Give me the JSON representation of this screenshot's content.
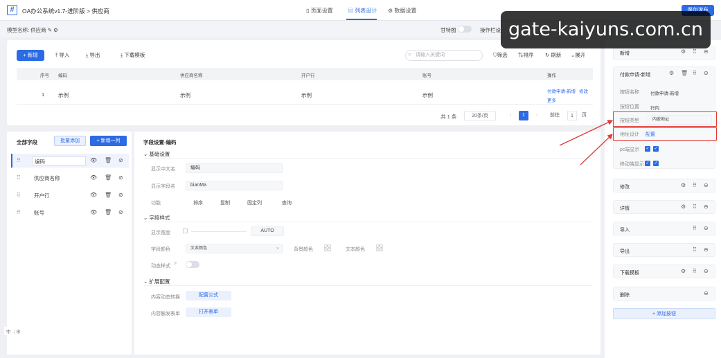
{
  "app": {
    "title": "OA办公系统v1.7-进阶版 > 供应商",
    "tabs": [
      {
        "label": "页面设置",
        "active": false
      },
      {
        "label": "列表设计",
        "active": true
      },
      {
        "label": "数据设置",
        "active": false
      }
    ],
    "save_label": "保存/发布"
  },
  "model": {
    "label": "模型名称: 供应商",
    "switch_label": "甘特图",
    "switch2_label": "操作栏设"
  },
  "preview": {
    "toolbar": [
      "+ 新增",
      "导入",
      "导出",
      "下载模板"
    ],
    "search_placeholder": "请输入关键词",
    "right_tools": [
      "筛选",
      "排序",
      "刷新",
      "展开"
    ],
    "columns": [
      "序号",
      "编码",
      "供应商名称",
      "开户行",
      "账号",
      "操作"
    ],
    "row": {
      "index": "1",
      "code": "示例",
      "name": "示例",
      "bank": "示例",
      "account": "示例",
      "actions": [
        "付款申请-新增",
        "修改",
        "更多"
      ]
    },
    "pager": {
      "total": "共 1 条",
      "page_size": "20条/页",
      "current": "1",
      "goto_label": "前往",
      "goto_value": "1",
      "page_suffix": "页"
    }
  },
  "fields": {
    "title": "全部字段",
    "batch_label": "批量添加",
    "new_label": "+ 新增一列",
    "items": [
      "编码",
      "供应商名称",
      "开户行",
      "账号"
    ]
  },
  "settings": {
    "title": "字段设置-编码",
    "basic": {
      "heading": "基础设置",
      "display_name_label": "显示中文名",
      "display_name_value": "编码",
      "field_name_label": "显示字段名",
      "field_name_value": "bianMa",
      "func_label": "功能",
      "func_opts": [
        "排序",
        "复制",
        "固定列",
        "查询"
      ]
    },
    "style": {
      "heading": "字段样式",
      "width_label": "显示宽度",
      "width_value": "AUTO",
      "color_label": "字段颜色",
      "color_value": "文本颜色",
      "bg_label": "背景颜色",
      "text_color_label": "文本颜色",
      "dynamic_label": "动态样式"
    },
    "ext": {
      "heading": "扩展配置",
      "convert_label": "内容动态转换",
      "convert_btn": "配置公式",
      "trigger_label": "内容触发表单",
      "trigger_btn": "打开表单"
    }
  },
  "right": {
    "cards": [
      {
        "title": "新增"
      },
      {
        "title": "付款申请-新增"
      },
      {
        "title": "修改"
      },
      {
        "title": "详情"
      },
      {
        "title": "导入"
      },
      {
        "title": "导出"
      },
      {
        "title": "下载模板"
      },
      {
        "title": "删除"
      }
    ],
    "detail": {
      "name_label": "按钮名称",
      "name_value": "付款申请-新增",
      "pos_label": "按钮位置",
      "pos_value": "行内",
      "type_label": "按钮类型",
      "type_value": "内嵌地址",
      "addr_label": "地址设计",
      "addr_value": "配置",
      "pc_label": "pc端显示",
      "mobile_label": "移动端显示"
    },
    "add_label": "+ 添加按钮"
  },
  "watermark": "gate-kaiyuns.com.cn",
  "bottom_tools": "中 ·; ⊕"
}
